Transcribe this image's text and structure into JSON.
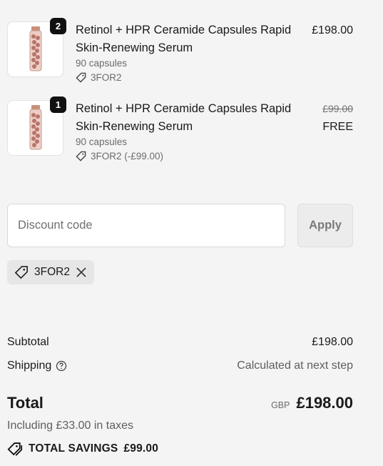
{
  "line_items": [
    {
      "quantity": "2",
      "title": "Retinol + HPR Ceramide Capsules Rapid Skin-Renewing Serum",
      "variant": "90 capsules",
      "discount": "3FOR2",
      "price": "£198.00"
    },
    {
      "quantity": "1",
      "title": "Retinol + HPR Ceramide Capsules Rapid Skin-Renewing Serum",
      "variant": "90 capsules",
      "discount": "3FOR2 (-£99.00)",
      "original_price": "£99.00",
      "price": "FREE"
    }
  ],
  "discount": {
    "placeholder": "Discount code",
    "apply_label": "Apply",
    "applied_code": "3FOR2"
  },
  "summary": {
    "subtotal_label": "Subtotal",
    "subtotal_value": "£198.00",
    "shipping_label": "Shipping",
    "shipping_value": "Calculated at next step",
    "total_label": "Total",
    "currency": "GBP",
    "total_value": "£198.00",
    "taxes_note": "Including £33.00 in taxes",
    "savings_label": "TOTAL SAVINGS",
    "savings_value": "£99.00"
  },
  "icons": [
    "tag-icon",
    "close-icon",
    "help-circle-icon",
    "product-bottle-icon"
  ]
}
